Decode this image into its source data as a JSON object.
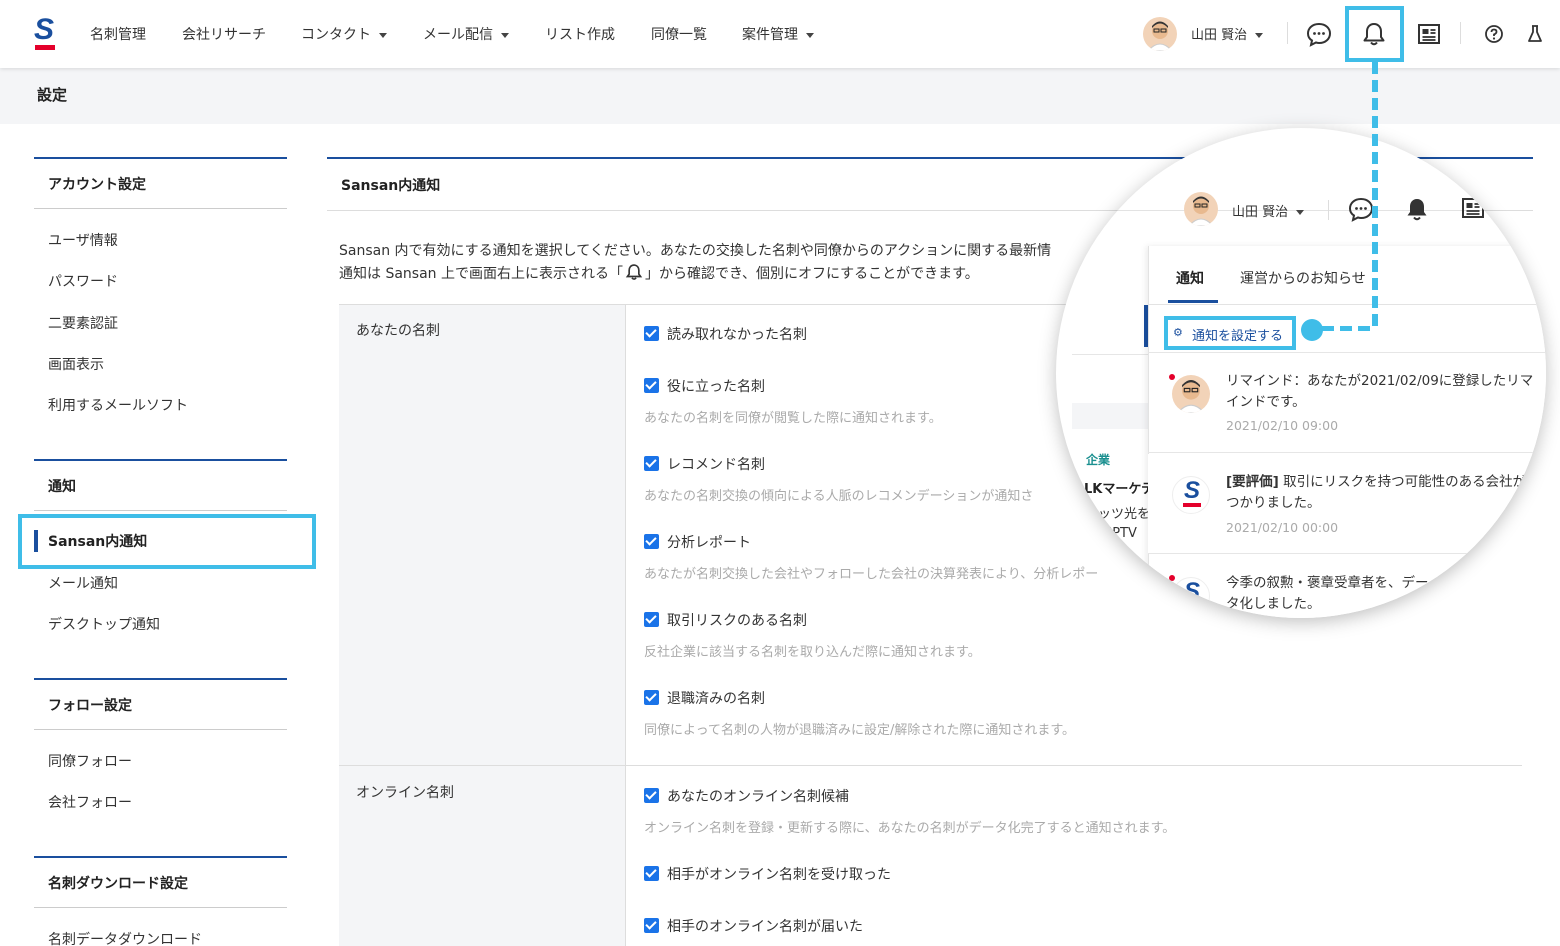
{
  "nav": {
    "items": [
      "名刺管理",
      "会社リサーチ",
      "コンタクト",
      "メール配信",
      "リスト作成",
      "同僚一覧",
      "案件管理"
    ],
    "user_name": "山田 賢治"
  },
  "page": {
    "title": "設定"
  },
  "sidebar": {
    "sections": [
      {
        "heading": "アカウント設定",
        "items": [
          "ユーザ情報",
          "パスワード",
          "二要素認証",
          "画面表示",
          "利用するメールソフト"
        ]
      },
      {
        "heading": "通知",
        "items": [
          "Sansan内通知",
          "メール通知",
          "デスクトップ通知"
        ]
      },
      {
        "heading": "フォロー設定",
        "items": [
          "同僚フォロー",
          "会社フォロー"
        ]
      },
      {
        "heading": "名刺ダウンロード設定",
        "items": [
          "名刺データダウンロード"
        ]
      }
    ],
    "active_item": "Sansan内通知"
  },
  "main": {
    "title": "Sansan内通知",
    "desc_line1": "Sansan 内で有効にする通知を選択してください。あなたの交換した名刺や同僚からのアクションに関する最新情",
    "desc_line2a": "通知は Sansan 上で画面右上に表示される「",
    "desc_line2b": "」から確認でき、個別にオフにすることができます。",
    "groups": [
      {
        "label": "あなたの名刺",
        "options": [
          {
            "label": "読み取れなかった名刺",
            "checked": true,
            "help": ""
          },
          {
            "label": "役に立った名刺",
            "checked": true,
            "help": "あなたの名刺を同僚が閲覧した際に通知されます。"
          },
          {
            "label": "レコメンド名刺",
            "checked": true,
            "help": "あなたの名刺交換の傾向による人脈のレコメンデーションが通知さ"
          },
          {
            "label": "分析レポート",
            "checked": true,
            "help": "あなたが名刺交換した会社やフォローした会社の決算発表により、分析レポー"
          },
          {
            "label": "取引リスクのある名刺",
            "checked": true,
            "help": "反社企業に該当する名刺を取り込んだ際に通知されます。"
          },
          {
            "label": "退職済みの名刺",
            "checked": true,
            "help": "同僚によって名刺の人物が退職済みに設定/解除された際に通知されます。"
          }
        ]
      },
      {
        "label": "オンライン名刺",
        "options": [
          {
            "label": "あなたのオンライン名刺候補",
            "checked": true,
            "help": "オンライン名刺を登録・更新する際に、あなたの名刺がデータ化完了すると通知されます。"
          },
          {
            "label": "相手がオンライン名刺を受け取った",
            "checked": true,
            "help": ""
          },
          {
            "label": "相手のオンライン名刺が届いた",
            "checked": true,
            "help": ""
          }
        ]
      }
    ]
  },
  "magnifier": {
    "user_name": "山田 賢治",
    "tabs": [
      "通知",
      "運営からのお知らせ"
    ],
    "settings_link": "通知を設定する",
    "bg_fragments": [
      "企業",
      "LKマーケテ",
      "ッツ光を",
      "/IPTV"
    ],
    "notifications": [
      {
        "text": "リマインド：あなたが2021/02/09に登録したリマインドです。",
        "time": "2021/02/10 09:00",
        "unread": true,
        "avatar": "user"
      },
      {
        "prefix": "[要評価]",
        "text": " 取引にリスクを持つ可能性のある会社が見つかりました。",
        "time": "2021/02/10 00:00",
        "unread": false,
        "avatar": "sansan"
      },
      {
        "text": "今季の叙勲・褒章受章者を、データ化しました。",
        "time": "",
        "unread": true,
        "avatar": "sansan"
      }
    ]
  },
  "colors": {
    "accent": "#1a4f9e",
    "highlight": "#3fbde8",
    "checkbox": "#1a73e8",
    "brand_red": "#e4002b"
  },
  "icons": [
    "chat-icon",
    "bell-icon",
    "news-icon",
    "help-icon",
    "flask-icon",
    "gear-icon"
  ]
}
